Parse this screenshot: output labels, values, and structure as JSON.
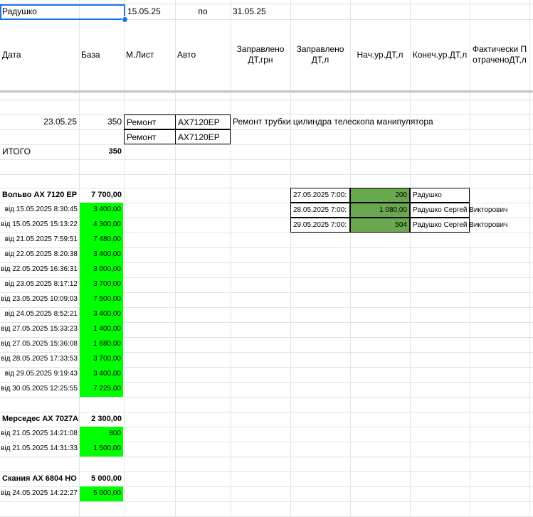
{
  "top": {
    "name": "Радушко",
    "date_from": "15.05.25",
    "po": "по",
    "date_to": "31.05.25"
  },
  "headers": {
    "data": "Дата",
    "baza": "База",
    "mlist": "М.Лист",
    "avto": "Авто",
    "zapr_grn": "Заправлено ДТ,грн",
    "zapr_l": "Заправлено ДТ,л",
    "nach": "Нач.ур.ДТ,л",
    "konech": "Конеч.ур.ДТ,л",
    "fakt": "Фактически ПотраченоДТ,л"
  },
  "repairs": [
    {
      "date": "23.05.25",
      "baza": "350",
      "mlist": "Ремонт",
      "avto": "АХ7120ЕР",
      "note": "Ремонт трубки цилиндра телескопа манипулятора"
    },
    {
      "date": "",
      "baza": "",
      "mlist": "Ремонт",
      "avto": "АХ7120ЕР",
      "note": ""
    }
  ],
  "itogo": {
    "label": "ИТОГО",
    "value": "350"
  },
  "groups": [
    {
      "title": "Вольво АХ 7120 ЕР",
      "total": "7 700,00",
      "rows": [
        {
          "label": "від 15.05.2025 8:30:45",
          "amount": "3 400,00"
        },
        {
          "label": "від 15.05.2025 15:13:22",
          "amount": "4 300,00"
        },
        {
          "label": "від 21.05.2025 7:59:51",
          "amount": "7 480,00"
        },
        {
          "label": "від 22.05.2025 8:20:38",
          "amount": "3 400,00"
        },
        {
          "label": "від 22.05.2025 16:36:31",
          "amount": "3 000,00"
        },
        {
          "label": "від 23.05.2025 8:17:12",
          "amount": "3 700,00"
        },
        {
          "label": "від 23.05.2025 10:09:03",
          "amount": "7 500,00"
        },
        {
          "label": "від 24.05.2025 8:52:21",
          "amount": "3 400,00"
        },
        {
          "label": "від 27.05.2025 15:33:23",
          "amount": "1 400,00"
        },
        {
          "label": "від 27.05.2025 15:36:08",
          "amount": "1 680,00"
        },
        {
          "label": "від 28.05.2025 17:33:53",
          "amount": "3 700,00"
        },
        {
          "label": "від 29.05.2025 9:19:43",
          "amount": "3 400,00"
        },
        {
          "label": "від 30.05.2025 12:25:55",
          "amount": "7 225,00"
        }
      ]
    },
    {
      "title": "Мерседес АХ 7027АМ",
      "total": "2 300,00",
      "rows": [
        {
          "label": "від 21.05.2025 14:21:08",
          "amount": "800"
        },
        {
          "label": "від 21.05.2025 14:31:33",
          "amount": "1 500,00"
        }
      ]
    },
    {
      "title": "Скания АХ 6804 НО",
      "total": "5 000,00",
      "rows": [
        {
          "label": "від 24.05.2025 14:22:27",
          "amount": "5 000,00"
        }
      ]
    }
  ],
  "right_table": [
    {
      "date": "27.05.2025 7:00:",
      "value": "200",
      "name": "Радушко"
    },
    {
      "date": "28.05.2025 7:00:",
      "value": "1 080,00",
      "name": "Радушко Сергей Викторович"
    },
    {
      "date": "29.05.2025 7:00:",
      "value": "504",
      "name": "Радушко Сергей Викторович"
    }
  ],
  "colors": {
    "green": "#00ff00",
    "dark_green": "#6aa84f",
    "selection": "#1a73e8"
  }
}
